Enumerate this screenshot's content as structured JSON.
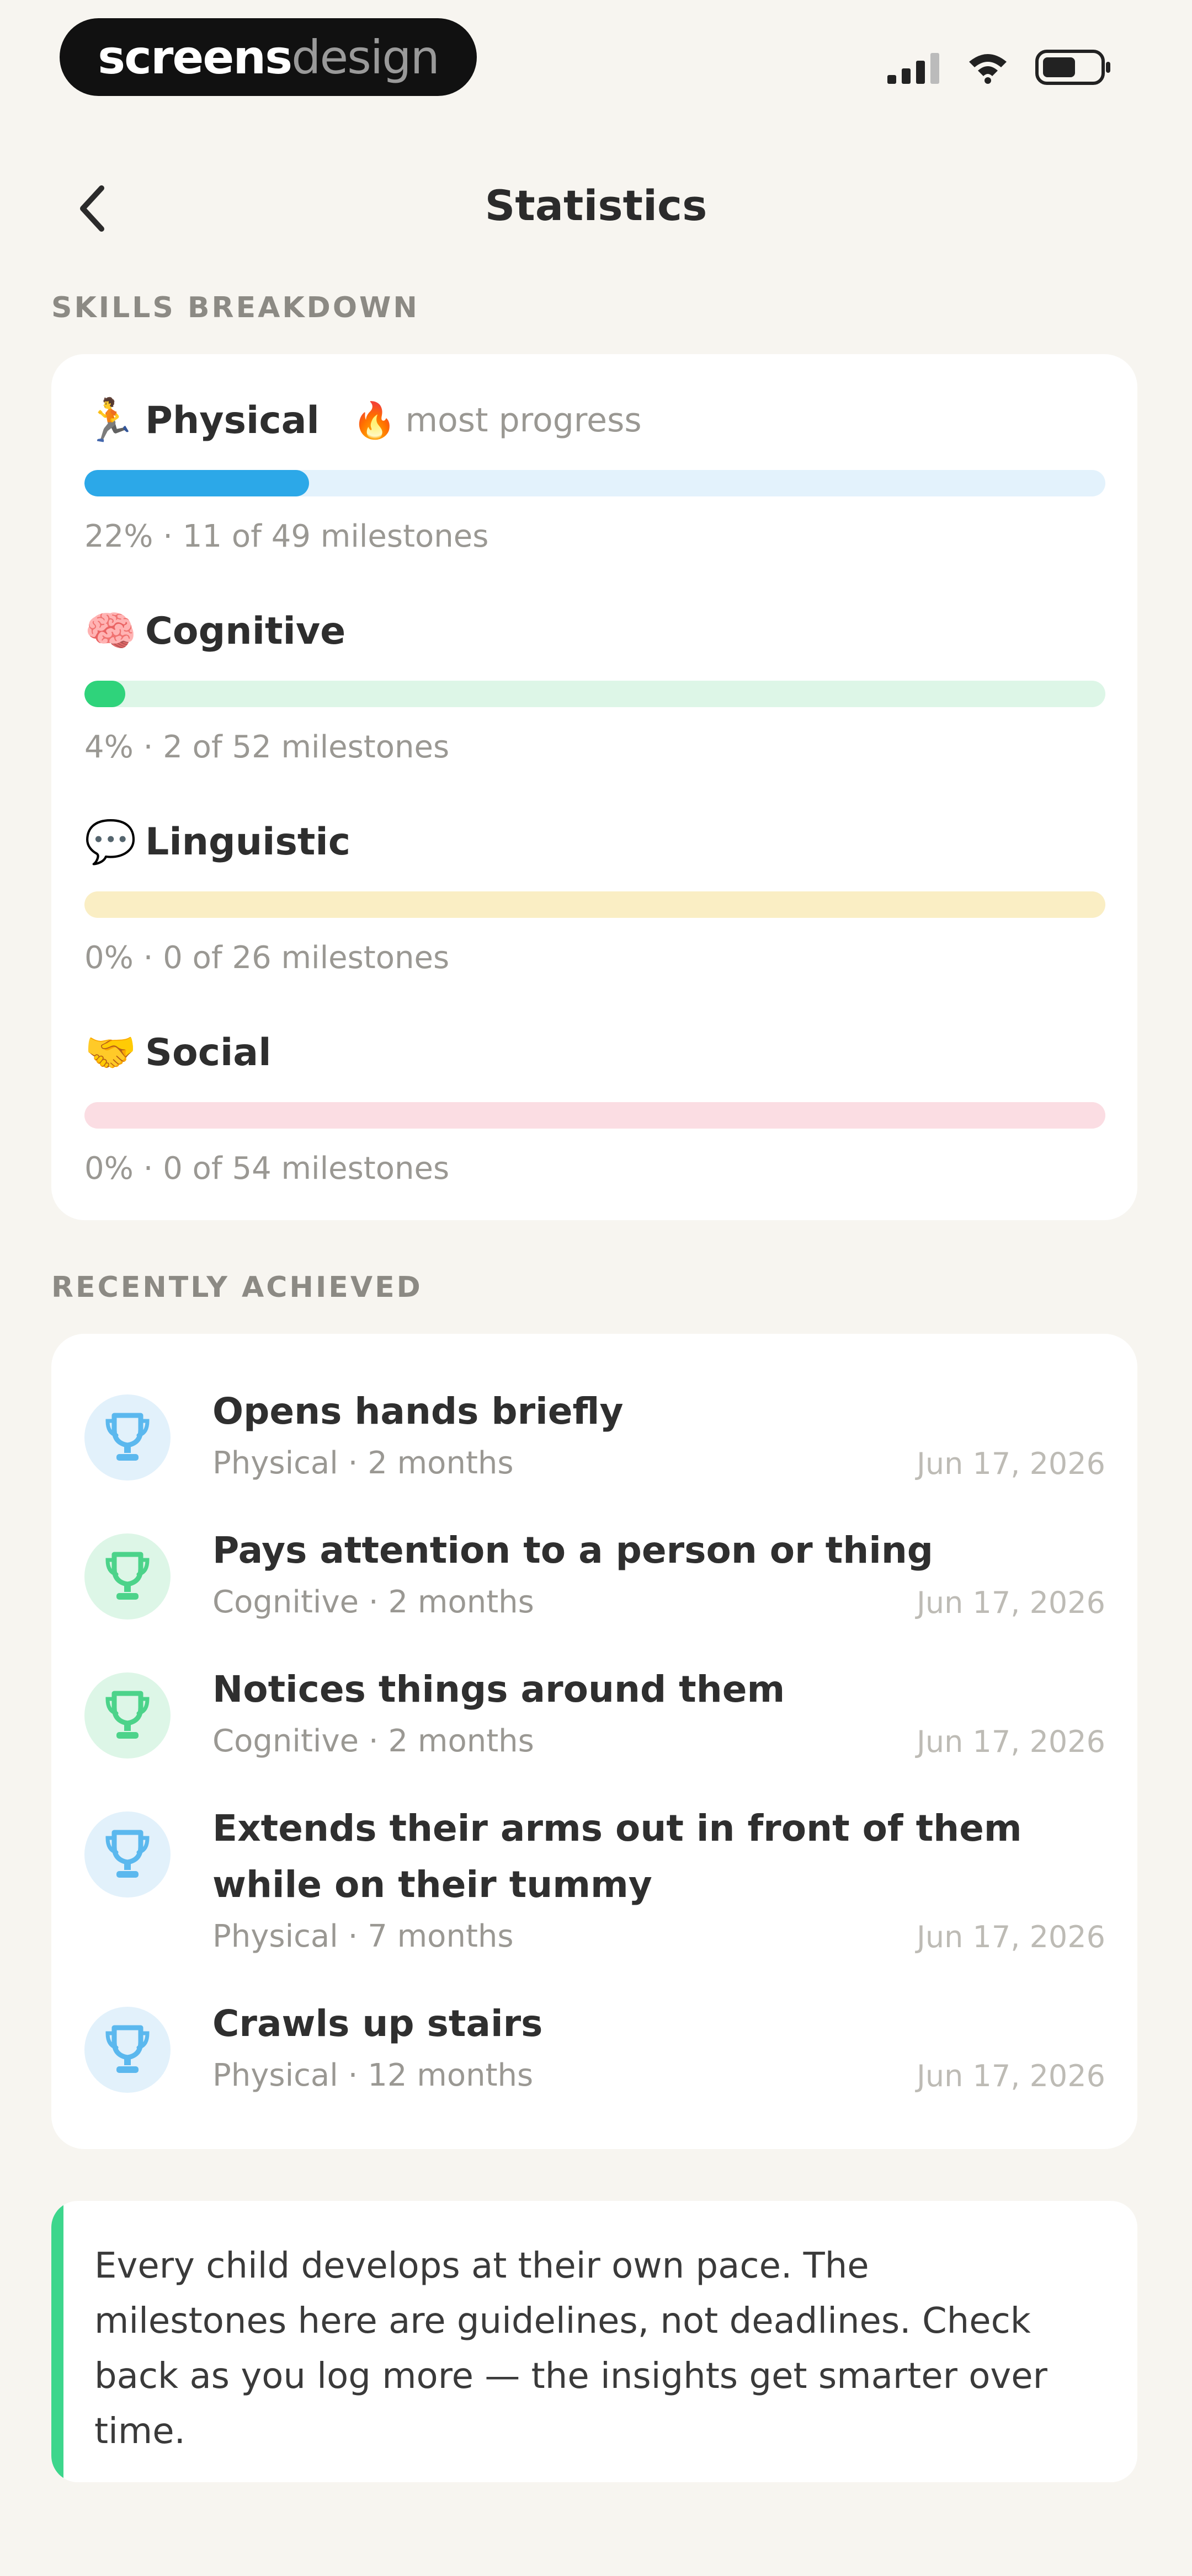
{
  "status_bar": {
    "brand_bold": "screens",
    "brand_light": "design"
  },
  "header": {
    "title": "Statistics"
  },
  "sections": {
    "skills_label": "SKILLS BREAKDOWN",
    "recent_label": "RECENTLY ACHIEVED"
  },
  "skills": [
    {
      "emoji": "🏃",
      "name": "Physical",
      "badge_emoji": "🔥",
      "badge": "most progress",
      "percent": 22,
      "achieved": 11,
      "total": 49,
      "meta": "22% · 11 of 49 milestones",
      "color": "#2CA8E8",
      "track": "#E3F2FC"
    },
    {
      "emoji": "🧠",
      "name": "Cognitive",
      "badge_emoji": "",
      "badge": "",
      "percent": 4,
      "achieved": 2,
      "total": 52,
      "meta": "4% · 2 of 52 milestones",
      "color": "#2FD37B",
      "track": "#DDF6E7"
    },
    {
      "emoji": "💬",
      "name": "Linguistic",
      "badge_emoji": "",
      "badge": "",
      "percent": 0,
      "achieved": 0,
      "total": 26,
      "meta": "0% · 0 of 26 milestones",
      "color": "#F2C94C",
      "track": "#FAEEC4"
    },
    {
      "emoji": "🤝",
      "name": "Social",
      "badge_emoji": "",
      "badge": "",
      "percent": 0,
      "achieved": 0,
      "total": 54,
      "meta": "0% · 0 of 54 milestones",
      "color": "#F08AA0",
      "track": "#FBDDE3"
    }
  ],
  "recent": [
    {
      "title": "Opens hands briefly",
      "sub": "Physical · 2 months",
      "date": "Jun 17, 2026",
      "category": "physical",
      "icon_color": "#5BB8EE",
      "icon_bg": "#E2F1FB"
    },
    {
      "title": "Pays attention to a person or thing",
      "sub": "Cognitive · 2 months",
      "date": "Jun 17, 2026",
      "category": "cognitive",
      "icon_color": "#4CD38A",
      "icon_bg": "#DDF6E7"
    },
    {
      "title": "Notices things around them",
      "sub": "Cognitive · 2 months",
      "date": "Jun 17, 2026",
      "category": "cognitive",
      "icon_color": "#4CD38A",
      "icon_bg": "#DDF6E7"
    },
    {
      "title": "Extends their arms out in front of them while on their tummy",
      "sub": "Physical · 7 months",
      "date": "Jun 17, 2026",
      "category": "physical",
      "icon_color": "#5BB8EE",
      "icon_bg": "#E2F1FB"
    },
    {
      "title": "Crawls up stairs",
      "sub": "Physical · 12 months",
      "date": "Jun 17, 2026",
      "category": "physical",
      "icon_color": "#5BB8EE",
      "icon_bg": "#E2F1FB"
    }
  ],
  "note": {
    "text": "Every child develops at their own pace. The milestones here are guidelines, not deadlines. Check back as you log more — the insights get smarter over time."
  },
  "colors": {
    "background": "#F7F5F0",
    "card": "#FFFFFF",
    "note_accent": "#3DD68C"
  }
}
